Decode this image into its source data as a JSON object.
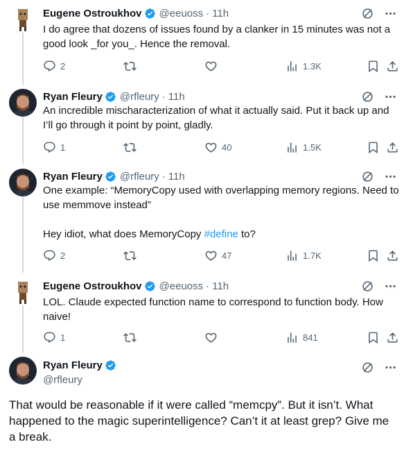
{
  "tweets": [
    {
      "name": "Eugene Ostroukhov",
      "handle": "@eeuoss",
      "sep": "·",
      "time": "11h",
      "text": "I do agree that dozens of issues found by a clanker in 15 minutes was not a good look _for you_. Hence the removal.",
      "replies": "2",
      "likes": "",
      "views": "1.3K"
    },
    {
      "name": "Ryan Fleury",
      "handle": "@rfleury",
      "sep": "·",
      "time": "11h",
      "text": "An incredible mischaracterization of what it actually said. Put it back up and I’ll go through it point by point, gladly.",
      "replies": "1",
      "likes": "40",
      "views": "1.5K"
    },
    {
      "name": "Ryan Fleury",
      "handle": "@rfleury",
      "sep": "·",
      "time": "11h",
      "text_line1": "One example: “MemoryCopy used with overlapping memory regions. Need to use memmove instead”",
      "text_line2_pre": "Hey idiot, what does MemoryCopy ",
      "text_line2_tag": "#define",
      "text_line2_post": " to?",
      "replies": "2",
      "likes": "47",
      "views": "1.7K"
    },
    {
      "name": "Eugene Ostroukhov",
      "handle": "@eeuoss",
      "sep": "·",
      "time": "11h",
      "text": "LOL. Claude expected function name to correspond to function body. How naive!",
      "replies": "1",
      "likes": "",
      "views": "841"
    }
  ],
  "focus": {
    "name": "Ryan Fleury",
    "handle": "@rfleury",
    "text": "That would be reasonable if it were called “memcpy”. But it isn’t. What happened to the magic superintelligence? Can’t it at least grep? Give me a break."
  },
  "colors": {
    "text": "#0f1419",
    "secondary": "#536471",
    "accent": "#1d9bf0",
    "thread_line": "#cfd9de"
  },
  "icons": [
    "reply-icon",
    "retweet-icon",
    "like-icon",
    "views-icon",
    "bookmark-icon",
    "share-icon",
    "grok-icon",
    "more-icon",
    "verified-badge-icon"
  ]
}
